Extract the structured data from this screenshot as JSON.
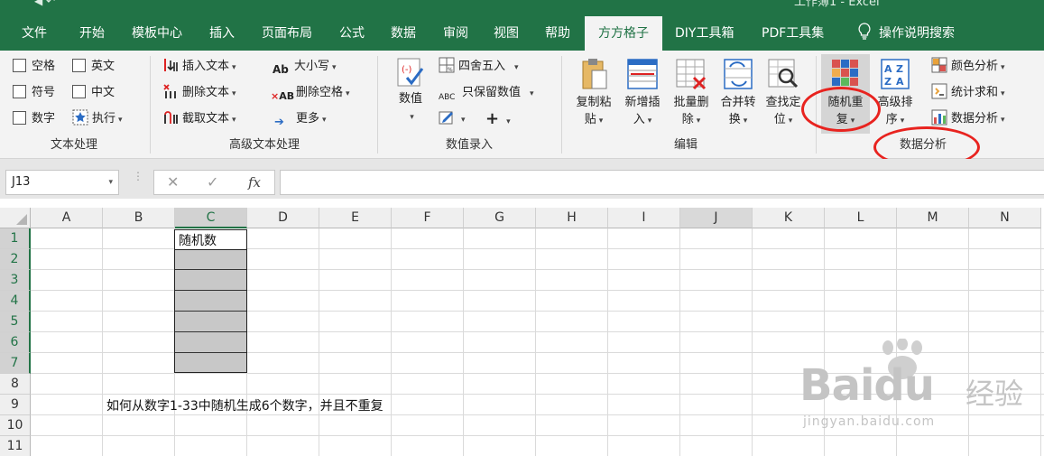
{
  "window": {
    "title_fragment": "工作簿1 - Excel"
  },
  "tabs": [
    {
      "label": "文件",
      "active": false
    },
    {
      "label": "开始",
      "active": false
    },
    {
      "label": "模板中心",
      "active": false
    },
    {
      "label": "插入",
      "active": false
    },
    {
      "label": "页面布局",
      "active": false
    },
    {
      "label": "公式",
      "active": false
    },
    {
      "label": "数据",
      "active": false
    },
    {
      "label": "审阅",
      "active": false
    },
    {
      "label": "视图",
      "active": false
    },
    {
      "label": "帮助",
      "active": false
    },
    {
      "label": "方方格子",
      "active": true
    },
    {
      "label": "DIY工具箱",
      "active": false
    },
    {
      "label": "PDF工具集",
      "active": false
    }
  ],
  "tell_me": {
    "label": "操作说明搜索",
    "icon": "lightbulb-icon"
  },
  "ribbon": {
    "text_group": {
      "label": "文本处理",
      "items": [
        "空格",
        "英文",
        "符号",
        "中文",
        "数字",
        "执行"
      ]
    },
    "advanced_text_group": {
      "label": "高级文本处理",
      "items": [
        "插入文本",
        "删除文本",
        "截取文本",
        "大小写",
        "删除空格",
        "更多"
      ]
    },
    "number_entry_group": {
      "label": "数值录入",
      "big_button": "数值",
      "items": [
        "四舍五入",
        "只保留数值"
      ]
    },
    "edit_group": {
      "label": "编辑",
      "buttons": [
        {
          "line1": "复制粘",
          "line2": "贴"
        },
        {
          "line1": "新增插",
          "line2": "入"
        },
        {
          "line1": "批量删",
          "line2": "除"
        },
        {
          "line1": "合并转",
          "line2": "换"
        },
        {
          "line1": "查找定",
          "line2": "位"
        }
      ]
    },
    "data_analysis_group": {
      "label": "数据分析",
      "buttons": [
        {
          "line1": "随机重",
          "line2": "复"
        },
        {
          "line1": "高级排",
          "line2": "序"
        }
      ],
      "items": [
        "颜色分析",
        "统计求和",
        "数据分析"
      ]
    }
  },
  "formula_bar": {
    "name_box": "J13",
    "cancel_symbol": "✕",
    "enter_symbol": "✓",
    "fx_symbol": "fx",
    "content": ""
  },
  "sheet": {
    "columns": [
      "A",
      "B",
      "C",
      "D",
      "E",
      "F",
      "G",
      "H",
      "I",
      "J",
      "K",
      "L",
      "M",
      "N"
    ],
    "rows": [
      "1",
      "2",
      "3",
      "4",
      "5",
      "6",
      "7",
      "8",
      "9",
      "10",
      "11"
    ],
    "cells": {
      "C1": "随机数",
      "B9": "如何从数字1-33中随机生成6个数字，并且不重复"
    }
  },
  "watermark": {
    "brand": "Baidu",
    "cn": "经验",
    "url": "jingyan.baidu.com"
  },
  "colors": {
    "excel_green": "#217346",
    "annotation_red": "#e8231f",
    "selected_range_fill": "#c8c8c8"
  }
}
